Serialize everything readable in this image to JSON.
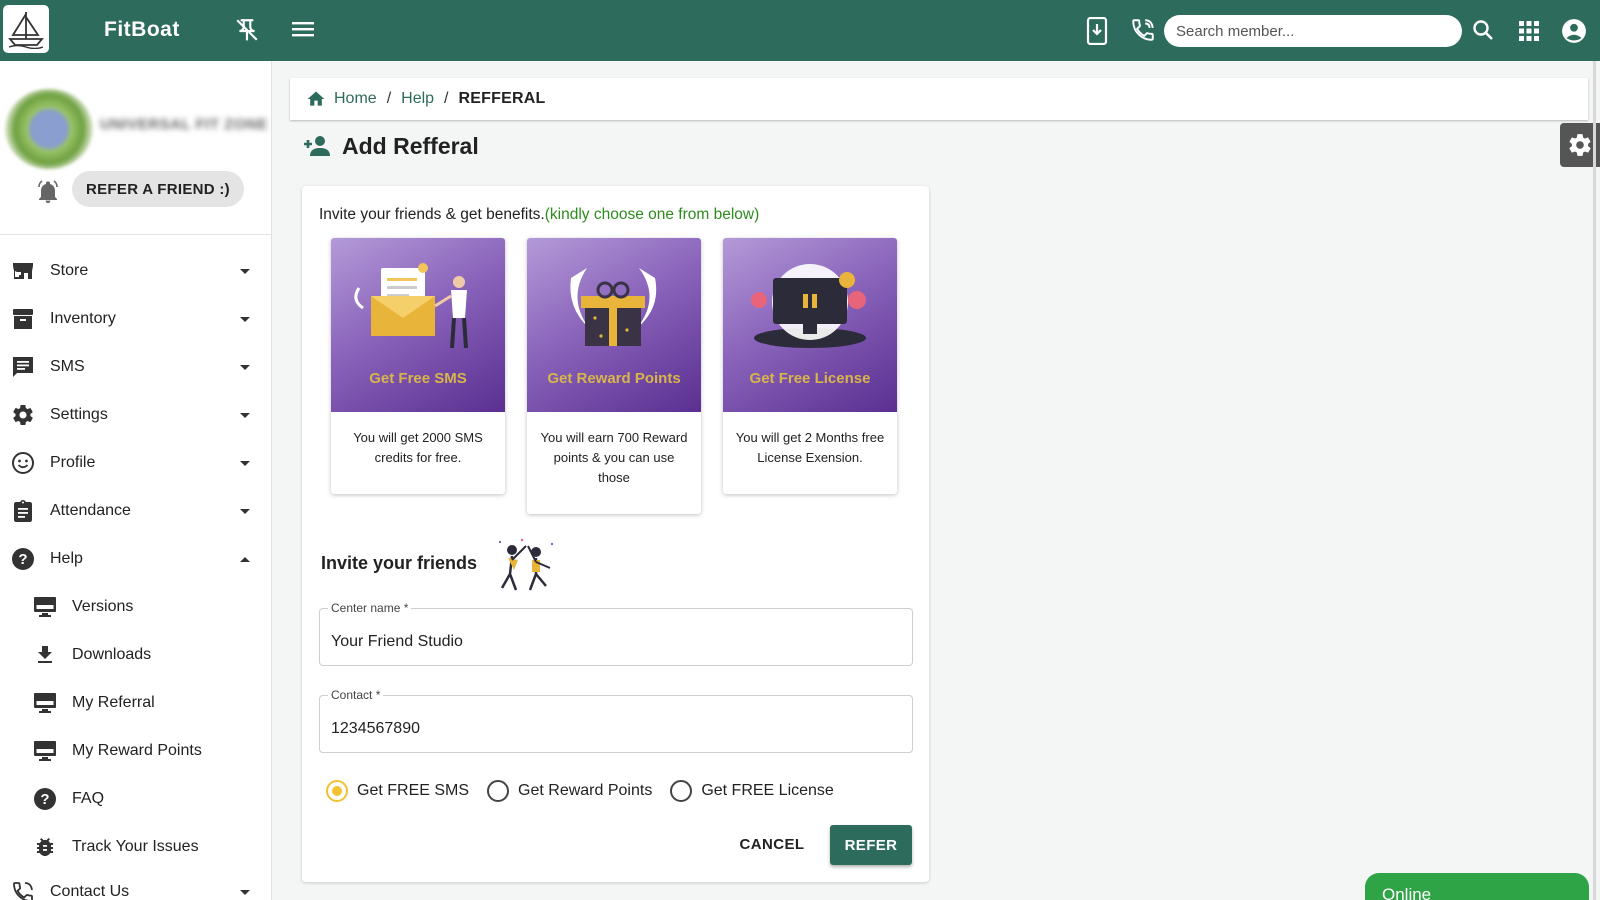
{
  "app": {
    "brand": "FitBoat",
    "search_placeholder": "Search member..."
  },
  "sidebar": {
    "gym_name": "UNIVERSAL FIT ZONE",
    "refer_chip": "REFER A FRIEND :)",
    "items": [
      {
        "label": "Store"
      },
      {
        "label": "Inventory"
      },
      {
        "label": "SMS"
      },
      {
        "label": "Settings"
      },
      {
        "label": "Profile"
      },
      {
        "label": "Attendance"
      },
      {
        "label": "Help"
      }
    ],
    "help_sub": [
      {
        "label": "Versions"
      },
      {
        "label": "Downloads"
      },
      {
        "label": "My Referral"
      },
      {
        "label": "My Reward Points"
      },
      {
        "label": "FAQ"
      },
      {
        "label": "Track Your Issues"
      }
    ],
    "contact": "Contact Us"
  },
  "breadcrumb": {
    "home": "Home",
    "help": "Help",
    "current": "REFFERAL"
  },
  "page": {
    "title": "Add Refferal",
    "invite_text": "Invite your friends & get benefits.",
    "invite_hint": "(kindly choose one from below)",
    "offers": [
      {
        "caption": "Get Free SMS",
        "desc": "You will get 2000 SMS credits for free."
      },
      {
        "caption": "Get Reward Points",
        "desc": "You will earn 700 Reward points & you can use those"
      },
      {
        "caption": "Get Free License",
        "desc": "You will get 2 Months free License Exension."
      }
    ],
    "friends_title": "Invite your friends",
    "center_label": "Center name *",
    "center_value": "Your Friend Studio",
    "contact_label": "Contact *",
    "contact_value": "1234567890",
    "radios": [
      "Get FREE SMS",
      "Get Reward Points",
      "Get FREE License"
    ],
    "selected_radio": "Get FREE SMS",
    "cancel": "CANCEL",
    "refer": "REFER"
  },
  "status": {
    "online": "Online"
  },
  "colors": {
    "primary": "#2d6b5c",
    "accent": "#f2c230",
    "hint_green": "#2e8b1e",
    "online_green": "#2ea447"
  }
}
